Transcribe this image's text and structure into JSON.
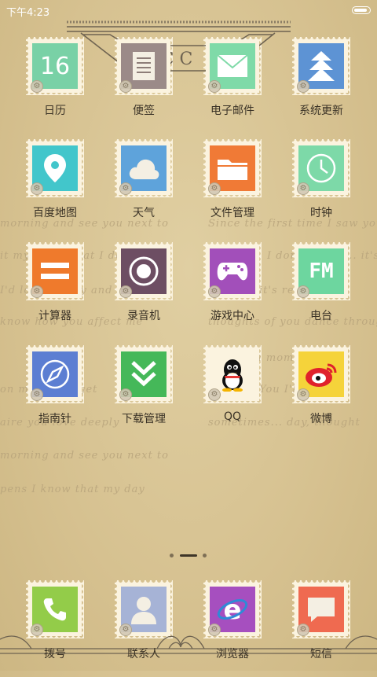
{
  "status_bar": {
    "time": "下午4:23"
  },
  "banner": {
    "text": "C C"
  },
  "background_script": [
    "morning and see you next to",
    "Since the first time I saw you",
    "it my be all that I dont",
    "I don't know ... it's",
    "I'd love deeply and say ing",
    "it's really",
    "know how you affect me",
    "thoughts of you dance through",
    "a moment   I'll",
    "on my day, toget",
    "You  I'll",
    "aire you love deeply",
    "sometimes... day, thought",
    "morning and see you next to",
    "pens  I know that my day"
  ],
  "apps": [
    {
      "label": "日历",
      "icon": "calendar-icon",
      "glyph": "16",
      "color": "#79d1a6"
    },
    {
      "label": "便签",
      "icon": "notes-icon",
      "glyph": "",
      "color": "#9b8a88"
    },
    {
      "label": "电子邮件",
      "icon": "email-icon",
      "glyph": "",
      "color": "#7fdaa8"
    },
    {
      "label": "系统更新",
      "icon": "system-update-icon",
      "glyph": "",
      "color": "#5d93d4"
    },
    {
      "label": "百度地图",
      "icon": "map-pin-icon",
      "glyph": "",
      "color": "#42c6cb"
    },
    {
      "label": "天气",
      "icon": "weather-cloud-icon",
      "glyph": "",
      "color": "#5ea3db"
    },
    {
      "label": "文件管理",
      "icon": "folder-icon",
      "glyph": "",
      "color": "#f07a36"
    },
    {
      "label": "时钟",
      "icon": "clock-icon",
      "glyph": "",
      "color": "#7dd9a8"
    },
    {
      "label": "计算器",
      "icon": "calculator-icon",
      "glyph": "",
      "color": "#ef7a2c"
    },
    {
      "label": "录音机",
      "icon": "recorder-icon",
      "glyph": "",
      "color": "#6d4e63"
    },
    {
      "label": "游戏中心",
      "icon": "gamepad-icon",
      "glyph": "",
      "color": "#a24fba"
    },
    {
      "label": "电台",
      "icon": "radio-fm-icon",
      "glyph": "FM",
      "color": "#6dd69f"
    },
    {
      "label": "指南针",
      "icon": "compass-icon",
      "glyph": "",
      "color": "#5c7ed2"
    },
    {
      "label": "下载管理",
      "icon": "download-icon",
      "glyph": "",
      "color": "#45b859"
    },
    {
      "label": "QQ",
      "icon": "qq-penguin-icon",
      "glyph": "",
      "color": "#fbf3df"
    },
    {
      "label": "微博",
      "icon": "weibo-icon",
      "glyph": "",
      "color": "#f5d33a"
    }
  ],
  "dock": [
    {
      "label": "拨号",
      "icon": "phone-icon",
      "color": "#93cc49"
    },
    {
      "label": "联系人",
      "icon": "contact-icon",
      "color": "#a6b3d6"
    },
    {
      "label": "浏览器",
      "icon": "browser-icon",
      "color": "#a64fbf"
    },
    {
      "label": "短信",
      "icon": "message-icon",
      "color": "#ef6a50"
    }
  ]
}
